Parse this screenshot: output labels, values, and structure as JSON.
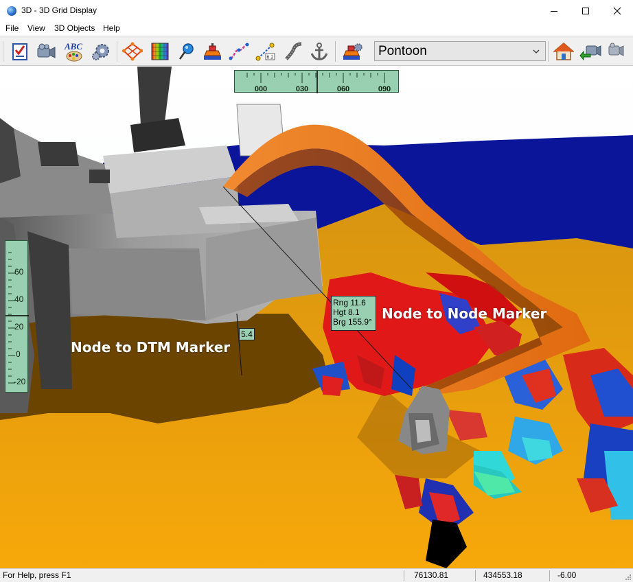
{
  "window": {
    "title": "3D - 3D Grid Display",
    "icons": {
      "app": "globe-icon",
      "min": "minimize-icon",
      "max": "maximize-icon",
      "close": "close-icon"
    }
  },
  "menu": [
    {
      "label": "File"
    },
    {
      "label": "View"
    },
    {
      "label": "3D Objects"
    },
    {
      "label": "Help"
    }
  ],
  "toolbar": {
    "tools": [
      {
        "icon": "checklist-icon"
      },
      {
        "icon": "camera-icon"
      },
      {
        "icon": "abc-palette-icon"
      },
      {
        "icon": "settings-gears-icon"
      },
      {
        "icon": "grid-network-icon"
      },
      {
        "icon": "color-grid-icon"
      },
      {
        "icon": "pin-marker-icon"
      },
      {
        "icon": "vessel-icon"
      },
      {
        "icon": "track-line-icon"
      },
      {
        "icon": "measure-icon"
      },
      {
        "icon": "rope-icon"
      },
      {
        "icon": "anchor-icon"
      },
      {
        "icon": "vessel-settings-icon"
      }
    ],
    "object_select": {
      "value": "Pontoon"
    },
    "right_tools": [
      {
        "icon": "home-icon"
      },
      {
        "icon": "camera-back-icon"
      },
      {
        "icon": "camera-forward-icon"
      }
    ],
    "accent_colors": {
      "orange": "#f07a10",
      "green_panel": "#9ad0b2"
    }
  },
  "viewport": {
    "compass": {
      "labels": [
        "000",
        "030",
        "060",
        "090"
      ]
    },
    "depth_scale": {
      "labels": [
        "60",
        "40",
        "20",
        "0",
        "-20"
      ]
    },
    "labels": {
      "node_to_dtm": "Node to DTM Marker",
      "node_to_node": "Node to Node Marker"
    },
    "range_box": {
      "rng": "Rng 11.6",
      "hgt": "Hgt 8.1",
      "brg": "Brg 155.9°"
    },
    "dtm_distance": "5.4",
    "colors": {
      "sea": "#0a1599",
      "seabed": "#f2a20a",
      "shadow": "#6b4400",
      "boom": "#e8720e",
      "hull": "#a4a4a4"
    }
  },
  "statusbar": {
    "help": "For Help, press F1",
    "easting": "76130.81",
    "northing": "434553.18",
    "depth": "-6.00"
  }
}
